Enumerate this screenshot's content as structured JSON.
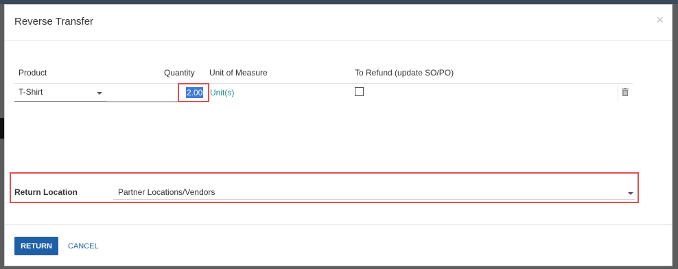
{
  "dialog": {
    "title": "Reverse Transfer",
    "close_glyph": "×"
  },
  "table": {
    "columns": {
      "product": "Product",
      "quantity": "Quantity",
      "uom": "Unit of Measure",
      "refund": "To Refund (update SO/PO)"
    },
    "rows": [
      {
        "product": "T-Shirt",
        "quantity": "2.00",
        "uom": "Unit(s)",
        "refund_checked": false
      }
    ]
  },
  "return_location": {
    "label": "Return Location",
    "value": "Partner Locations/Vendors"
  },
  "footer": {
    "return_label": "RETURN",
    "cancel_label": "CANCEL"
  },
  "colors": {
    "primary": "#1f5fa8",
    "link_teal": "#1d8b8b",
    "highlight_red": "#e05050",
    "selection_blue": "#3f7bd8"
  },
  "icons": {
    "delete_row": "trash-icon",
    "close": "close-icon",
    "dropdown": "chevron-down-icon"
  }
}
